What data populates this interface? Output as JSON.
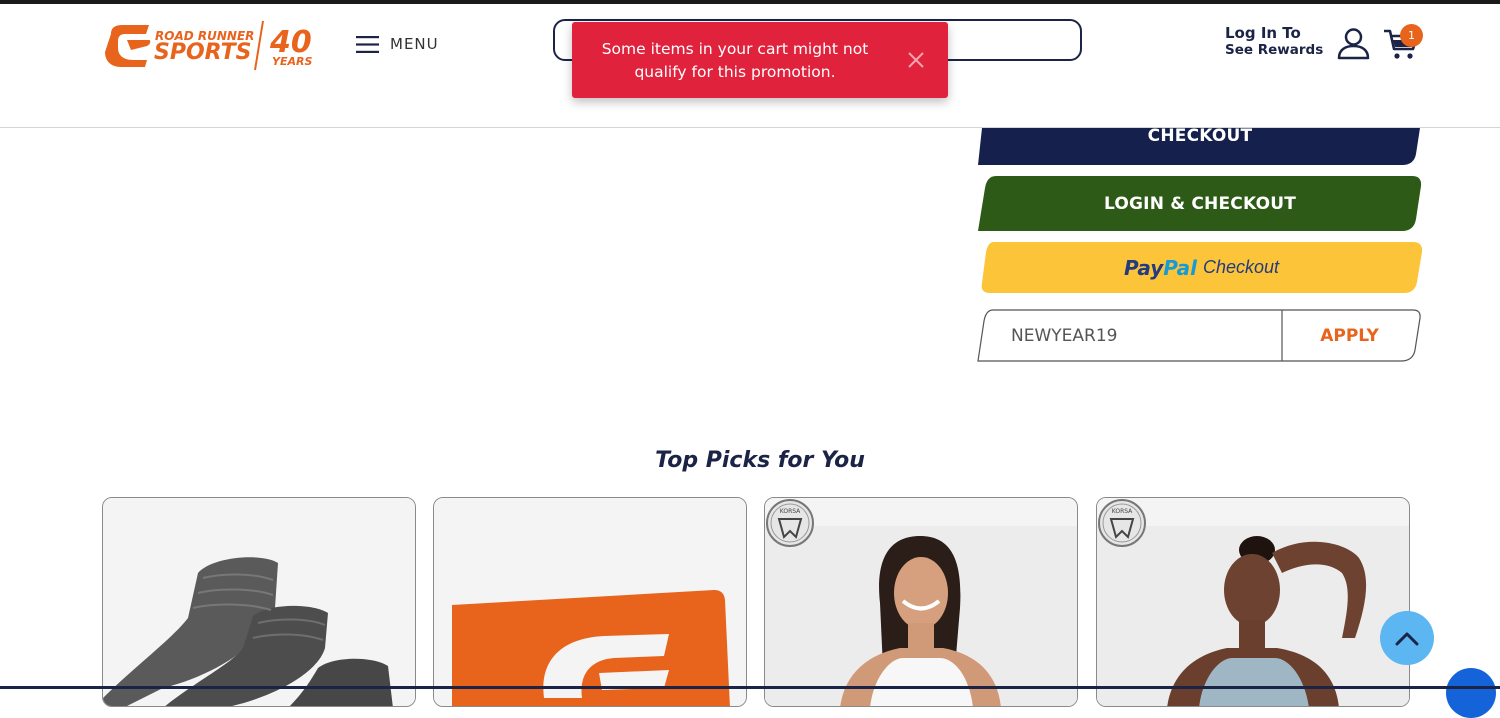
{
  "header": {
    "logo": {
      "line1": "ROAD RUNNER",
      "line2": "SPORTS",
      "years_num": "40",
      "years_label": "YEARS",
      "color": "#e8631c"
    },
    "menu_label": "MENU",
    "search_placeholder": "",
    "login_line1": "Log In To",
    "login_line2": "See Rewards",
    "cart_count": "1"
  },
  "toast": {
    "message": "Some items in your cart might not qualify for this promotion.",
    "color": "#e0223d"
  },
  "checkout": {
    "checkout_label": "CHECKOUT",
    "login_checkout_label": "LOGIN & CHECKOUT",
    "paypal_word1": "Pay",
    "paypal_word2": "Pal",
    "paypal_label": "Checkout",
    "promo_code_value": "NEWYEAR19",
    "apply_label": "APPLY",
    "colors": {
      "navy": "#15204d",
      "green": "#2d5a17",
      "paypal_yellow": "#fcc439",
      "orange": "#e8631c"
    }
  },
  "top_picks": {
    "title": "Top Picks for You",
    "products": [
      {
        "image": "gray-no-show-socks",
        "badge": ""
      },
      {
        "image": "road-runner-gift-card",
        "badge": ""
      },
      {
        "image": "woman-white-tank-top",
        "badge": "KORSA"
      },
      {
        "image": "woman-blue-tank-top",
        "badge": "KORSA"
      }
    ]
  }
}
